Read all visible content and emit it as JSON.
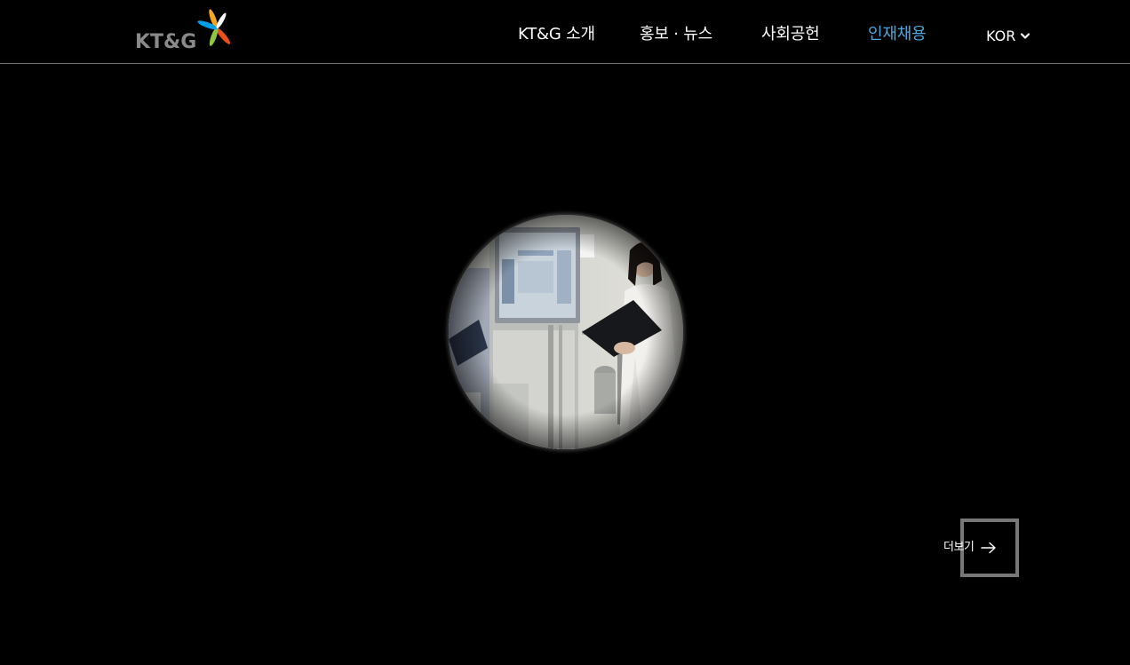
{
  "header": {
    "logo_text": "KT&G",
    "nav": [
      {
        "label": "KT&G 소개",
        "active": false
      },
      {
        "label": "홍보 · 뉴스",
        "active": false
      },
      {
        "label": "사회공헌",
        "active": false
      },
      {
        "label": "인재채용",
        "active": true
      }
    ],
    "language": "KOR"
  },
  "hero": {
    "more_label": "더보기"
  },
  "colors": {
    "background": "#000000",
    "active_nav": "#4aa8e0",
    "header_border": "#6e6e6e",
    "frame": "#777777"
  },
  "icons": [
    "kt-g-logo",
    "chevron-down-icon",
    "arrow-right-icon"
  ]
}
